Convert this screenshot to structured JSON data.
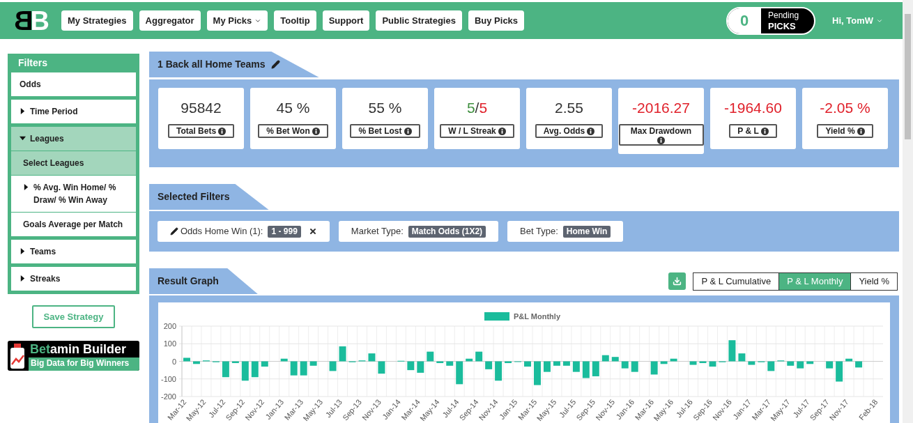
{
  "header": {
    "logo": "BB",
    "nav": [
      {
        "label": "My Strategies",
        "dropdown": false
      },
      {
        "label": "Aggregator",
        "dropdown": false
      },
      {
        "label": "My Picks",
        "dropdown": true
      },
      {
        "label": "Tooltip",
        "dropdown": false
      },
      {
        "label": "Support",
        "dropdown": false
      },
      {
        "label": "Public Strategies",
        "dropdown": false
      },
      {
        "label": "Buy Picks",
        "dropdown": false
      }
    ],
    "pending": {
      "count": "0",
      "label": "Pending",
      "sublabel": "PICKS"
    },
    "user": {
      "label": "Hi, TomW",
      "dropdown": true
    }
  },
  "sidebar": {
    "title": "Filters",
    "items": [
      {
        "label": "Odds",
        "kind": "plain",
        "expanded": false
      },
      {
        "label": "Time Period",
        "kind": "group",
        "expanded": false
      },
      {
        "label": "Leagues",
        "kind": "group",
        "expanded": true,
        "children": [
          {
            "label": "Select Leagues",
            "kind": "plain",
            "selected": true
          },
          {
            "label": "% Avg. Win Home/ % Draw/ % Win Away",
            "kind": "group",
            "selected": false,
            "expanded": false
          },
          {
            "label": "Goals Average per Match",
            "kind": "plain",
            "selected": false
          }
        ]
      },
      {
        "label": "Teams",
        "kind": "group",
        "expanded": false
      },
      {
        "label": "Streaks",
        "kind": "group",
        "expanded": false
      }
    ],
    "save_button": "Save Strategy",
    "banner": {
      "highlight": "Bet",
      "rest": "amin Builder",
      "tagline": "Big Data for Big Winners"
    }
  },
  "strategy": {
    "title": "1 Back all Home Teams",
    "stats": [
      {
        "kind": "plain",
        "value": "95842",
        "label": "Total Bets",
        "negative": false
      },
      {
        "kind": "plain",
        "value": "45 %",
        "label": "% Bet Won",
        "negative": false
      },
      {
        "kind": "plain",
        "value": "55 %",
        "label": "% Bet Lost",
        "negative": false
      },
      {
        "kind": "streak",
        "wins": "5",
        "separator": "/",
        "losses": "5",
        "label": "W / L Streak"
      },
      {
        "kind": "plain",
        "value": "2.55",
        "label": "Avg. Odds",
        "negative": false
      },
      {
        "kind": "plain",
        "value": "-2016.27",
        "label": "Max Drawdown",
        "negative": true
      },
      {
        "kind": "plain",
        "value": "-1964.60",
        "label": "P & L",
        "negative": true
      },
      {
        "kind": "plain",
        "value": "-2.05 %",
        "label": "Yield %",
        "negative": true
      }
    ]
  },
  "selected_filters": {
    "title": "Selected Filters",
    "chips": [
      {
        "label": "Odds Home Win (1):",
        "value": "1 - 999",
        "editable": true,
        "removable": true
      },
      {
        "label": "Market Type:",
        "value": "Match Odds (1X2)",
        "editable": false,
        "removable": false
      },
      {
        "label": "Bet Type:",
        "value": "Home Win",
        "editable": false,
        "removable": false
      }
    ]
  },
  "result_graph": {
    "title": "Result Graph",
    "views": [
      {
        "label": "P & L Cumulative",
        "selected": false
      },
      {
        "label": "P & L Monthly",
        "selected": true
      },
      {
        "label": "Yield %",
        "selected": false
      }
    ],
    "chart_data": {
      "type": "bar",
      "categories": [
        "Mar-12",
        null,
        "May-12",
        null,
        "Jul-12",
        null,
        "Sep-12",
        null,
        "Nov-12",
        null,
        "Jan-13",
        null,
        "Mar-13",
        null,
        "May-13",
        null,
        "Jul-13",
        null,
        "Sep-13",
        null,
        "Nov-13",
        null,
        "Jan-14",
        null,
        "Mar-14",
        null,
        "May-14",
        null,
        "Jul-14",
        null,
        "Sep-14",
        null,
        "Nov-14",
        null,
        "Jan-15",
        null,
        "Mar-15",
        null,
        "May-15",
        null,
        "Jul-15",
        null,
        "Sep-15",
        null,
        "Nov-15",
        null,
        "Jan-16",
        null,
        "Mar-16",
        null,
        "May-16",
        null,
        "Jul-16",
        null,
        "Sep-16",
        null,
        "Nov-16",
        null,
        "Jan-17",
        null,
        "Mar-17",
        null,
        "May-17",
        null,
        "Jul-17",
        null,
        "Sep-17",
        null,
        "Nov-17",
        null,
        null,
        "Feb-18"
      ],
      "series": [
        {
          "name": "P&L Monthly",
          "color": "#1abc9c",
          "values": [
            20,
            -15,
            5,
            -5,
            -90,
            -10,
            -110,
            -90,
            -30,
            0,
            15,
            -80,
            -80,
            -25,
            0,
            -55,
            85,
            -5,
            5,
            45,
            -70,
            0,
            3,
            -50,
            -65,
            55,
            -10,
            -25,
            -130,
            15,
            55,
            -45,
            -110,
            -10,
            -2,
            -30,
            -135,
            -60,
            -25,
            -25,
            -60,
            -95,
            -85,
            35,
            25,
            -40,
            -60,
            0,
            -75,
            -15,
            15,
            0,
            -20,
            -10,
            -30,
            -5,
            120,
            45,
            -20,
            -5,
            -55,
            5,
            -25,
            -40,
            -15,
            0,
            -40,
            -115,
            15,
            -35,
            0,
            0
          ]
        }
      ],
      "ylim": [
        -200,
        200
      ],
      "yticks": [
        -200,
        -100,
        0,
        100,
        200
      ]
    }
  }
}
